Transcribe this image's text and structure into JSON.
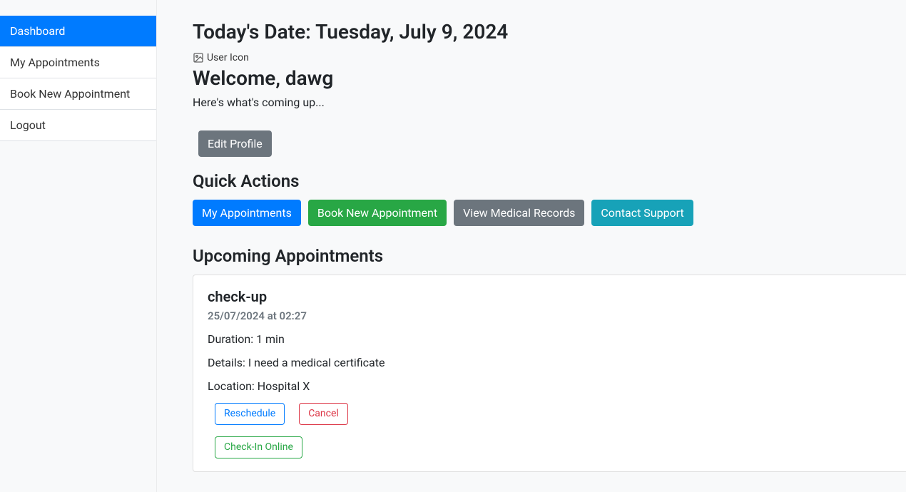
{
  "sidebar": {
    "items": [
      {
        "label": "Dashboard",
        "active": true
      },
      {
        "label": "My Appointments",
        "active": false
      },
      {
        "label": "Book New Appointment",
        "active": false
      },
      {
        "label": "Logout",
        "active": false
      }
    ]
  },
  "header": {
    "date_prefix": "Today's Date: ",
    "date_value": "Tuesday, July 9, 2024",
    "user_icon_alt": "User Icon",
    "welcome_prefix": "Welcome, ",
    "username": "dawg",
    "subtitle": "Here's what's coming up..."
  },
  "profile": {
    "edit_label": "Edit Profile"
  },
  "quick_actions": {
    "title": "Quick Actions",
    "buttons": {
      "my_appointments": "My Appointments",
      "book_new": "Book New Appointment",
      "view_records": "View Medical Records",
      "contact_support": "Contact Support"
    }
  },
  "upcoming": {
    "title": "Upcoming Appointments",
    "appointment": {
      "type": "check-up",
      "datetime": "25/07/2024 at 02:27",
      "duration_label": "Duration: ",
      "duration_value": "1 min",
      "details_label": "Details: ",
      "details_value": "I need a medical certificate",
      "location_label": "Location: ",
      "location_value": "Hospital X",
      "actions": {
        "reschedule": "Reschedule",
        "cancel": "Cancel",
        "checkin": "Check-In Online"
      }
    }
  }
}
